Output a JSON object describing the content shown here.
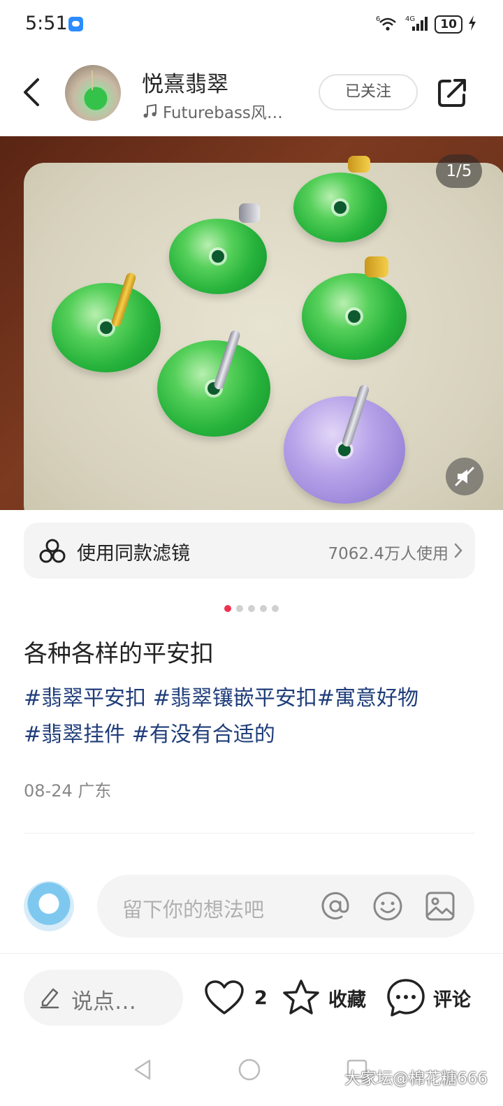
{
  "status_bar": {
    "time": "5:51",
    "network_label": "4G",
    "signal_label": "6",
    "battery_level": "10"
  },
  "header": {
    "author_name": "悦熹翡翠",
    "music_label": "Futurebass风…",
    "follow_label": "已关注"
  },
  "image": {
    "page_indicator": "1/5",
    "total_pages": 5,
    "current_page": 1
  },
  "filter": {
    "label": "使用同款滤镜",
    "usage": "7062.4万人使用"
  },
  "post": {
    "title": "各种各样的平安扣",
    "tags": [
      "#翡翠平安扣",
      "#翡翠镶嵌平安扣",
      "#寓意好物",
      "#翡翠挂件",
      "#有没有合适的"
    ],
    "date_location": "08-24 广东"
  },
  "comment_input": {
    "placeholder": "留下你的想法吧"
  },
  "bottom_bar": {
    "say_label": "说点…",
    "like_count": "2",
    "collect_label": "收藏",
    "comment_label": "评论"
  },
  "watermark": "大家坛@棉花糖666",
  "colors": {
    "accent": "#f0324f",
    "tag_color": "#1f3d7a",
    "panel_bg": "#f4f4f4"
  }
}
